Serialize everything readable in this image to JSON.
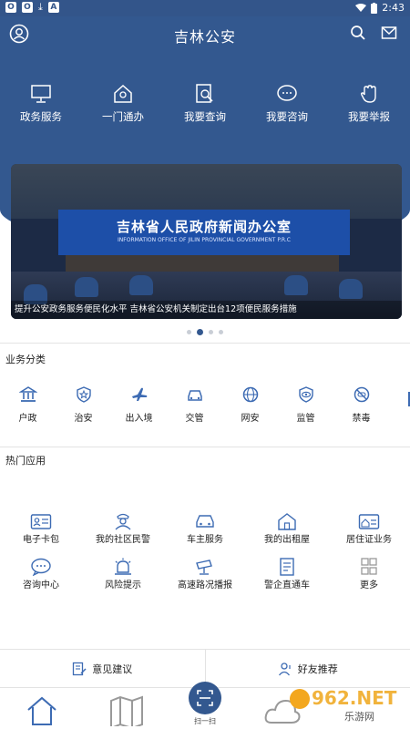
{
  "status": {
    "time": "2:43",
    "left_icons": [
      "o-icon",
      "o-icon",
      "download-icon",
      "a-icon"
    ]
  },
  "header": {
    "title": "吉林公安"
  },
  "quick_actions": [
    {
      "label": "政务服务",
      "icon": "monitor-icon"
    },
    {
      "label": "一门通办",
      "icon": "home-badge-icon"
    },
    {
      "label": "我要查询",
      "icon": "search-doc-icon"
    },
    {
      "label": "我要咨询",
      "icon": "chat-icon"
    },
    {
      "label": "我要举报",
      "icon": "hand-icon"
    }
  ],
  "banner": {
    "screen_cn": "吉林省人民政府新闻办公室",
    "screen_en": "INFORMATION OFFICE OF JILIN PROVINCIAL GOVERNMENT P.R.C",
    "caption": "提升公安政务服务便民化水平 吉林省公安机关制定出台12项便民服务措施",
    "pages": 4,
    "active_page": 2
  },
  "categories": {
    "title": "业务分类",
    "items": [
      {
        "label": "户政",
        "icon": "bank-icon"
      },
      {
        "label": "治安",
        "icon": "shield-star-icon"
      },
      {
        "label": "出入境",
        "icon": "airplane-icon"
      },
      {
        "label": "交管",
        "icon": "car-icon"
      },
      {
        "label": "网安",
        "icon": "globe-icon"
      },
      {
        "label": "监管",
        "icon": "eye-icon"
      },
      {
        "label": "禁毒",
        "icon": "no-drug-icon"
      }
    ]
  },
  "hot_apps": {
    "title": "热门应用",
    "row1": [
      {
        "label": "电子卡包",
        "icon": "id-card-icon"
      },
      {
        "label": "我的社区民警",
        "icon": "police-icon"
      },
      {
        "label": "车主服务",
        "icon": "car-icon"
      },
      {
        "label": "我的出租屋",
        "icon": "house-icon"
      },
      {
        "label": "居住证业务",
        "icon": "residence-card-icon"
      }
    ],
    "row2": [
      {
        "label": "咨询中心",
        "icon": "chat-icon"
      },
      {
        "label": "风险提示",
        "icon": "alarm-icon"
      },
      {
        "label": "高速路况播报",
        "icon": "camera-icon"
      },
      {
        "label": "警企直通车",
        "icon": "document-icon"
      },
      {
        "label": "更多",
        "icon": "grid-icon"
      }
    ]
  },
  "feedback": {
    "suggest": "意见建议",
    "recommend": "好友推荐"
  },
  "tabbar": {
    "scan_label": "扫一扫"
  },
  "watermark": {
    "brand": "962.NET",
    "sub": "乐游网"
  },
  "colors": {
    "primary": "#33588f",
    "accent": "#3d6bb3"
  }
}
